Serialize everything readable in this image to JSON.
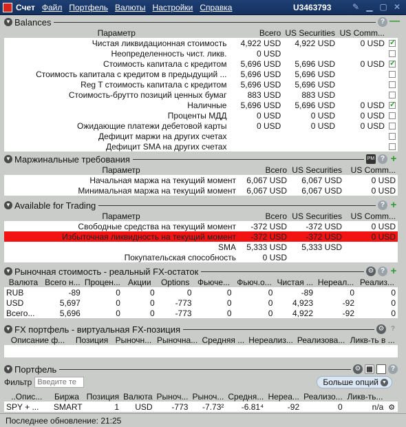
{
  "titlebar": {
    "title": "Счет",
    "menu": [
      "Файл",
      "Портфель",
      "Валюты",
      "Настройки",
      "Справка"
    ],
    "account": "U3463793"
  },
  "balances": {
    "title": "Balances",
    "headers": [
      "Параметр",
      "Всего",
      "US Securities",
      "US Comm..."
    ],
    "rows": [
      {
        "label": "Чистая ликвидационная стоимость",
        "total": "4,922 USD",
        "sec": "4,922 USD",
        "comm": "0 USD",
        "check": true
      },
      {
        "label": "Неопределенность чист. ликв.",
        "total": "0 USD",
        "sec": "",
        "comm": "",
        "check": false
      },
      {
        "label": "Стоимость капитала с кредитом",
        "total": "5,696 USD",
        "sec": "5,696 USD",
        "comm": "0 USD",
        "check": true
      },
      {
        "label": "Стоимость капитала с кредитом в предыдущий ...",
        "total": "5,696 USD",
        "sec": "5,696 USD",
        "comm": "",
        "check": false
      },
      {
        "label": "Reg T стоимость капитала с кредитом",
        "total": "5,696 USD",
        "sec": "5,696 USD",
        "comm": "",
        "check": false
      },
      {
        "label": "Стоимость-брутто позиций ценных бумаг",
        "total": "883 USD",
        "sec": "883 USD",
        "comm": "",
        "check": false
      },
      {
        "label": "Наличные",
        "total": "5,696 USD",
        "sec": "5,696 USD",
        "comm": "0 USD",
        "check": true
      },
      {
        "label": "Проценты МДД",
        "total": "0 USD",
        "sec": "0 USD",
        "comm": "0 USD",
        "check": false
      },
      {
        "label": "Ожидающие платежи дебетовой карты",
        "total": "0 USD",
        "sec": "0 USD",
        "comm": "0 USD",
        "check": false
      },
      {
        "label": "Дефицит маржи на других счетах",
        "total": "",
        "sec": "",
        "comm": "",
        "check": false
      },
      {
        "label": "Дефицит SMA на других счетах",
        "total": "",
        "sec": "",
        "comm": "",
        "check": false
      }
    ]
  },
  "margin": {
    "title": "Маржинальные требования",
    "headers": [
      "Параметр",
      "Всего",
      "US Securities",
      "US Comm..."
    ],
    "rows": [
      {
        "label": "Начальная маржа на текущий момент",
        "total": "6,067 USD",
        "sec": "6,067 USD",
        "comm": "0 USD"
      },
      {
        "label": "Минимальная маржа на текущий момент",
        "total": "6,067 USD",
        "sec": "6,067 USD",
        "comm": "0 USD"
      }
    ]
  },
  "trading": {
    "title": "Available for Trading",
    "headers": [
      "Параметр",
      "Всего",
      "US Securities",
      "US Comm..."
    ],
    "rows": [
      {
        "label": "Свободные средства на текущий момент",
        "total": "-372 USD",
        "sec": "-372 USD",
        "comm": "0 USD",
        "alert": false
      },
      {
        "label": "Избыточная ликвидность на текущий момент",
        "total": "-372 USD",
        "sec": "-372 USD",
        "comm": "0 USD",
        "alert": true
      },
      {
        "label": "SMA",
        "total": "5,333 USD",
        "sec": "5,333 USD",
        "comm": "",
        "alert": false
      },
      {
        "label": "Покупательская способность",
        "total": "0 USD",
        "sec": "",
        "comm": "",
        "alert": false
      }
    ]
  },
  "fx_market": {
    "title": "Рыночная стоимость - реальный FX-остаток",
    "headers": [
      "Валюта",
      "Всего н...",
      "Процен...",
      "Акции",
      "Options",
      "Фьючe...",
      "Фьюч.о...",
      "Чистая ...",
      "Нереал...",
      "Реализ..."
    ],
    "rows": [
      [
        "RUB",
        "-89",
        "0",
        "0",
        "0",
        "0",
        "0",
        "-89",
        "0",
        "0"
      ],
      [
        "USD",
        "5,697",
        "0",
        "0",
        "-773",
        "0",
        "0",
        "4,923",
        "-92",
        "0"
      ],
      [
        "Всего...",
        "5,696",
        "0",
        "0",
        "-773",
        "0",
        "0",
        "4,922",
        "-92",
        "0"
      ]
    ]
  },
  "fx_portfolio": {
    "title": "FX портфель - виртуальная FX-позиция",
    "headers": [
      "Описание ф...",
      "Позиция",
      "Рыночн...",
      "Рыночна...",
      "Средняя ...",
      "Нереализ...",
      "Реализова...",
      "Ликв-ть в ..."
    ]
  },
  "portfolio": {
    "title": "Портфель",
    "filter_label": "Фильтр",
    "filter_placeholder": "Введите те",
    "more_label": "Больше опций",
    "headers": [
      "..Опис...",
      "Биржа",
      "Позиция",
      "Валюта",
      "Рыноч...",
      "Рыноч...",
      "Средня...",
      "Нереа...",
      "Реализо...",
      "Ликв-ть..."
    ],
    "rows": [
      [
        "SPY + ...",
        "SMART",
        "1",
        "USD",
        "-773",
        "-7.73²",
        "-6.81⁴",
        "-92",
        "0",
        "n/a"
      ]
    ]
  },
  "status": {
    "label": "Последнее обновление:",
    "time": "21:25"
  }
}
